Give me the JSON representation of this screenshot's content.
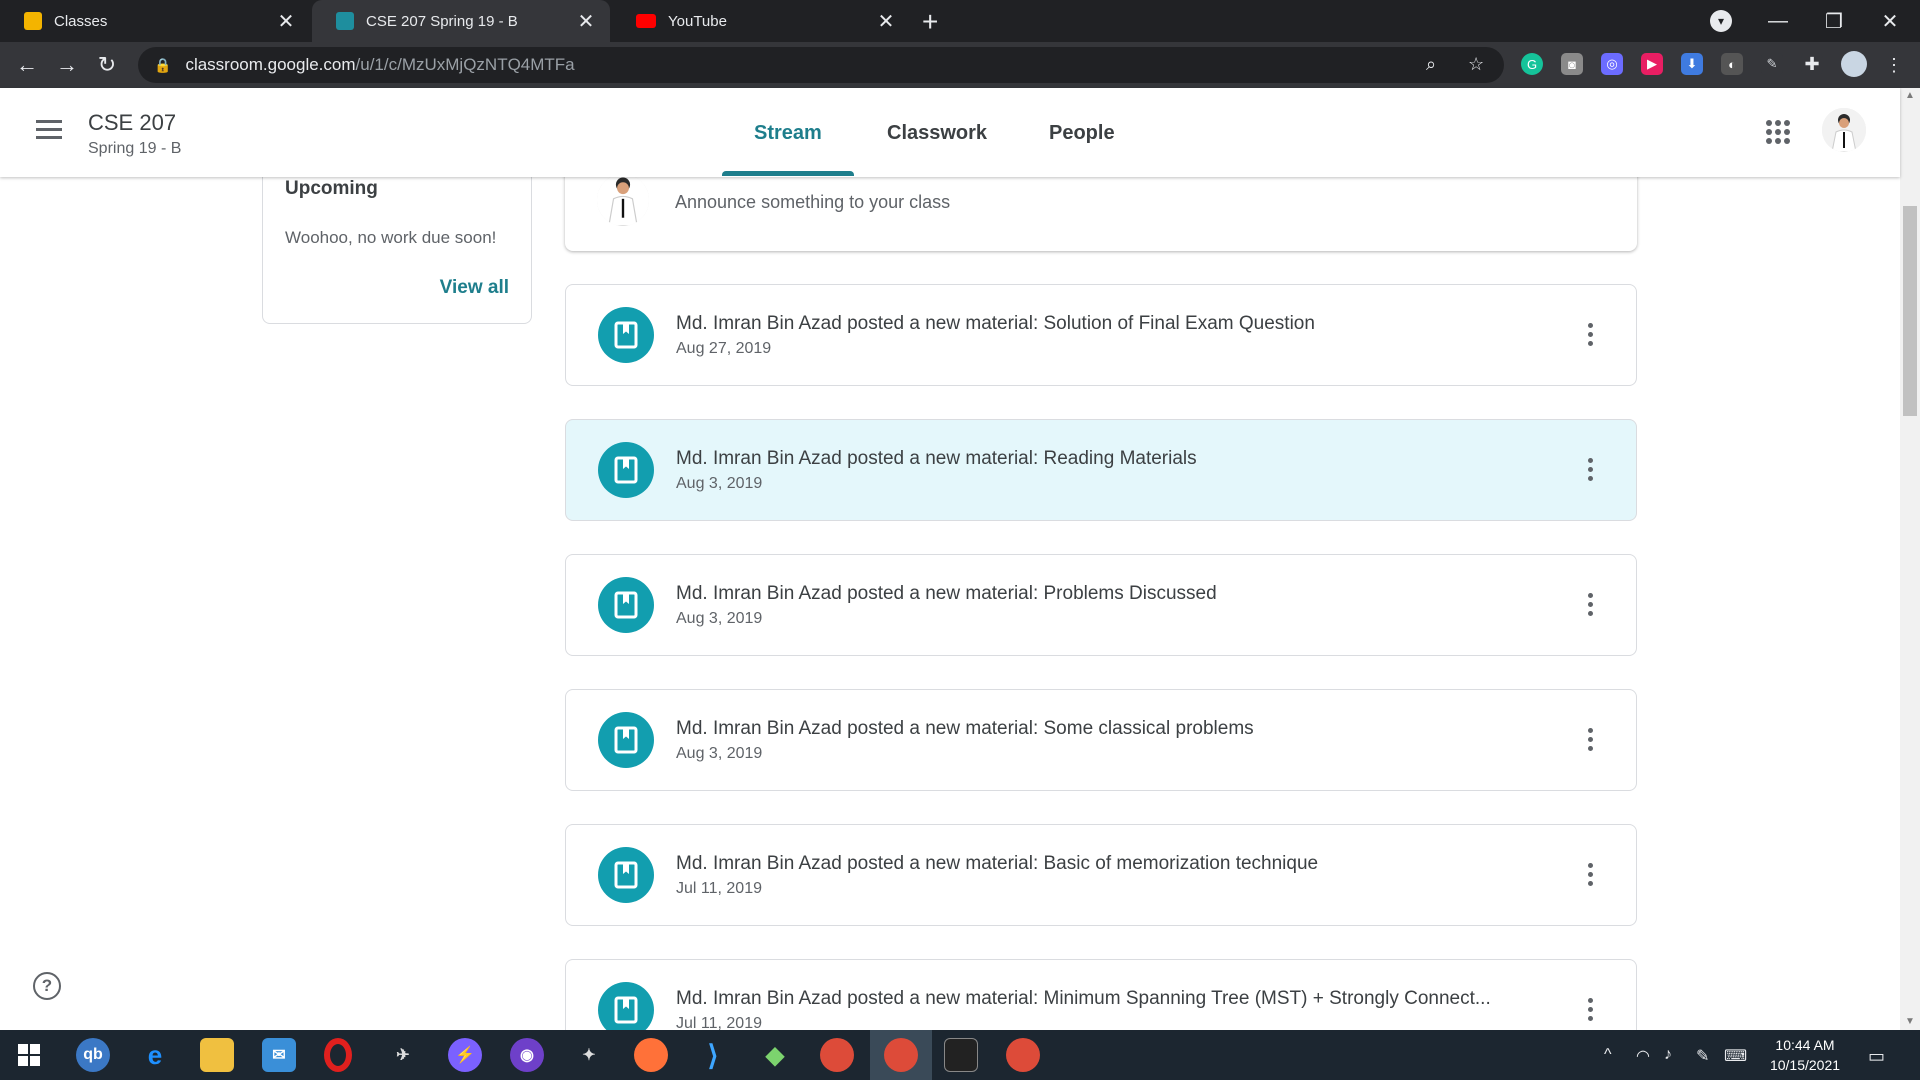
{
  "browser": {
    "tabs": [
      {
        "title": "Classes",
        "favicon": "classroom-icon",
        "color": "#f4b400"
      },
      {
        "title": "CSE 207 Spring 19 - B",
        "favicon": "classroom-icon",
        "color": "#1e8e9e"
      },
      {
        "title": "YouTube",
        "favicon": "youtube-icon",
        "color": "#ff0000"
      }
    ],
    "url_host": "classroom.google.com",
    "url_path": "/u/1/c/MzUxMjQzNTQ4MTFa"
  },
  "header": {
    "course_title": "CSE 207",
    "course_section": "Spring 19 - B",
    "tabs": [
      "Stream",
      "Classwork",
      "People"
    ],
    "active_tab": "Stream"
  },
  "upcoming": {
    "title": "Upcoming",
    "empty_text": "Woohoo, no work due soon!",
    "view_all": "View all"
  },
  "announce": {
    "placeholder": "Announce something to your class"
  },
  "posts": [
    {
      "text": "Md. Imran Bin Azad posted a new material: Solution of Final Exam Question",
      "date": "Aug 27, 2019"
    },
    {
      "text": "Md. Imran Bin Azad posted a new material: Reading Materials",
      "date": "Aug 3, 2019"
    },
    {
      "text": "Md. Imran Bin Azad posted a new material: Problems Discussed",
      "date": "Aug 3, 2019"
    },
    {
      "text": "Md. Imran Bin Azad posted a new material: Some classical problems",
      "date": "Aug 3, 2019"
    },
    {
      "text": "Md. Imran Bin Azad posted a new material: Basic of memorization technique",
      "date": "Jul 11, 2019"
    },
    {
      "text": "Md. Imran Bin Azad posted a new material: Minimum Spanning Tree (MST) + Strongly Connect...",
      "date": "Jul 11, 2019"
    }
  ],
  "taskbar": {
    "time": "10:44 AM",
    "date": "10/15/2021"
  },
  "colors": {
    "accent": "#1e7e8c",
    "material_icon": "#129eaf",
    "highlight": "#e4f7fb"
  }
}
